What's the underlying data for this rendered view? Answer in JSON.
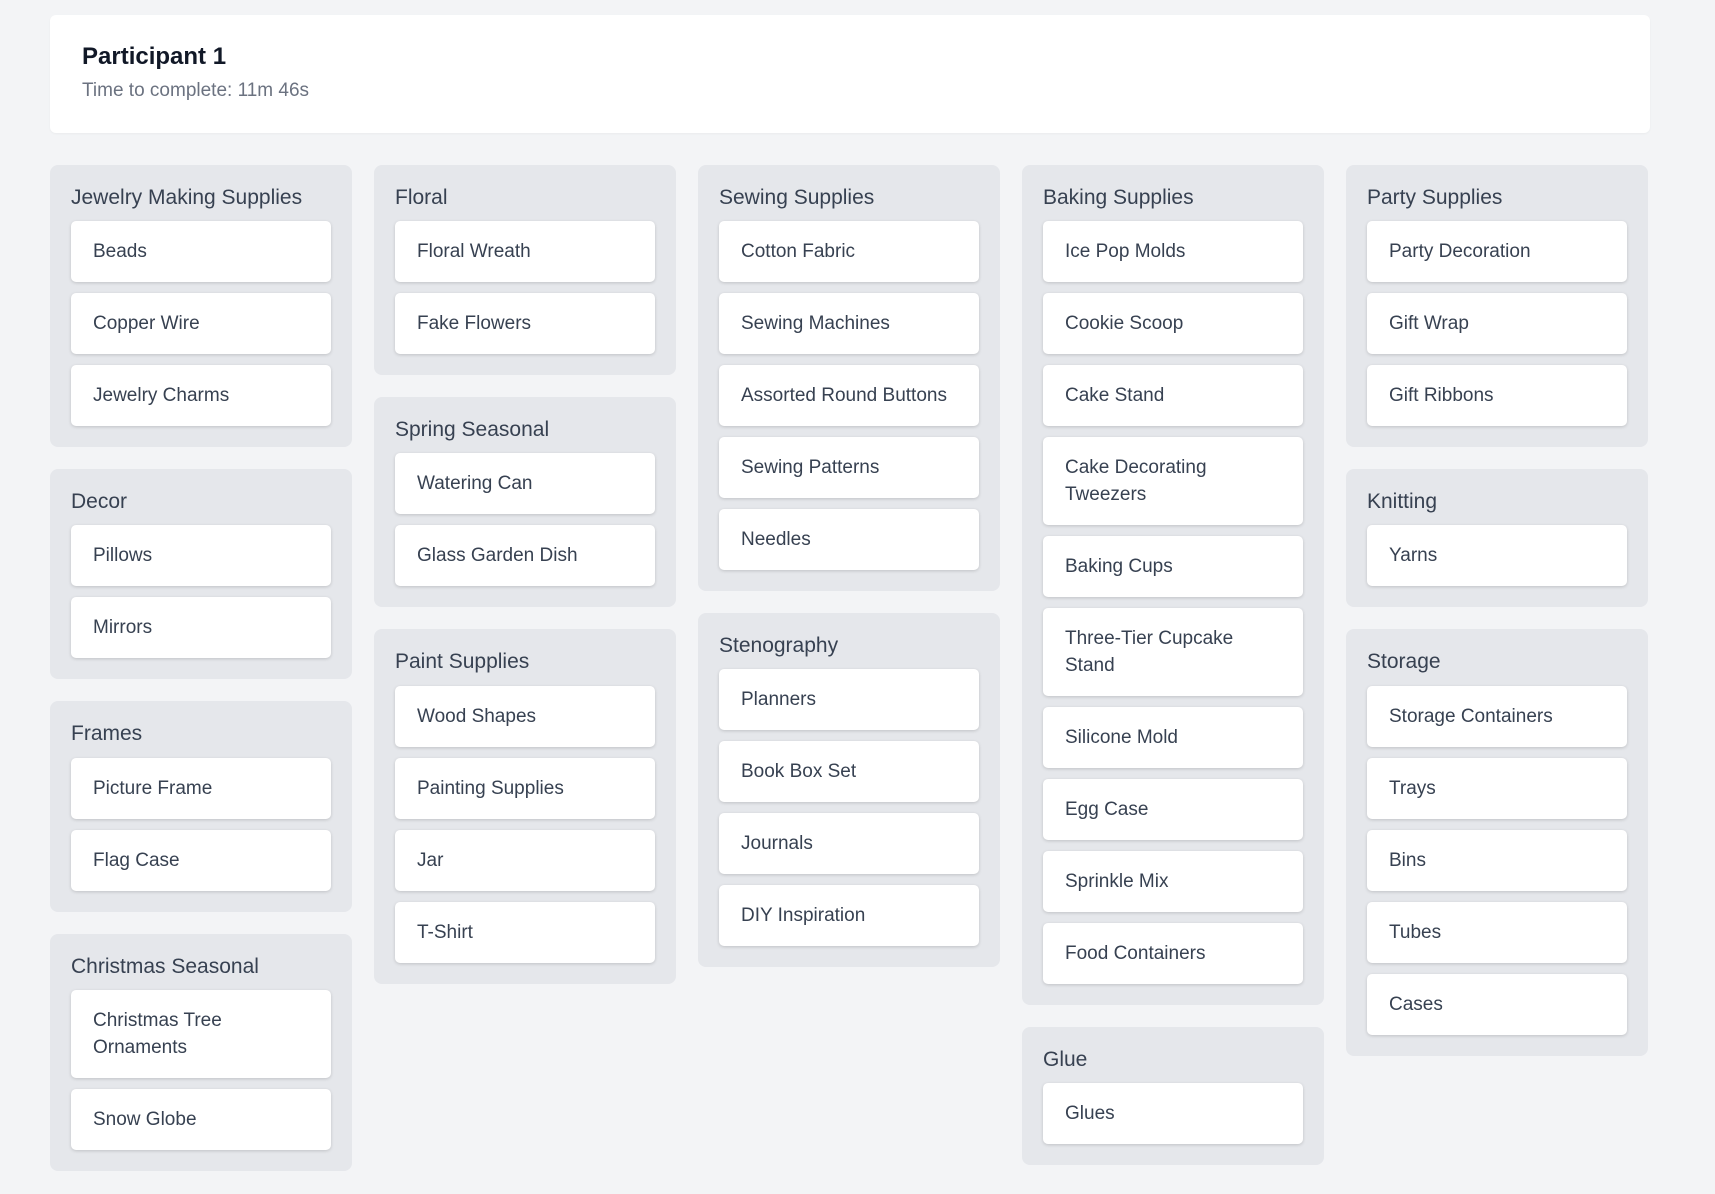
{
  "header": {
    "title": "Participant 1",
    "subtitle": "Time to complete: 11m 46s"
  },
  "columns": [
    [
      {
        "title": "Jewelry Making Supplies",
        "items": [
          "Beads",
          "Copper Wire",
          "Jewelry Charms"
        ]
      },
      {
        "title": "Decor",
        "items": [
          "Pillows",
          "Mirrors"
        ]
      },
      {
        "title": "Frames",
        "items": [
          "Picture Frame",
          "Flag Case"
        ]
      },
      {
        "title": "Christmas Seasonal",
        "items": [
          "Christmas Tree Ornaments",
          "Snow Globe"
        ]
      }
    ],
    [
      {
        "title": "Floral",
        "items": [
          "Floral Wreath",
          "Fake Flowers"
        ]
      },
      {
        "title": "Spring Seasonal",
        "items": [
          "Watering Can",
          "Glass Garden Dish"
        ]
      },
      {
        "title": "Paint Supplies",
        "items": [
          "Wood Shapes",
          "Painting Supplies",
          "Jar",
          "T-Shirt"
        ]
      }
    ],
    [
      {
        "title": "Sewing Supplies",
        "items": [
          "Cotton Fabric",
          "Sewing Machines",
          "Assorted Round Buttons",
          "Sewing Patterns",
          "Needles"
        ]
      },
      {
        "title": "Stenography",
        "items": [
          "Planners",
          "Book Box Set",
          "Journals",
          "DIY Inspiration"
        ]
      }
    ],
    [
      {
        "title": "Baking Supplies",
        "items": [
          "Ice Pop Molds",
          "Cookie Scoop",
          "Cake Stand",
          "Cake Decorating Tweezers",
          "Baking Cups",
          "Three-Tier Cupcake Stand",
          "Silicone Mold",
          "Egg Case",
          "Sprinkle Mix",
          "Food Containers"
        ]
      },
      {
        "title": "Glue",
        "items": [
          "Glues"
        ]
      }
    ],
    [
      {
        "title": "Party Supplies",
        "items": [
          "Party Decoration",
          "Gift Wrap",
          "Gift Ribbons"
        ]
      },
      {
        "title": "Knitting",
        "items": [
          "Yarns"
        ]
      },
      {
        "title": "Storage",
        "items": [
          "Storage Containers",
          "Trays",
          "Bins",
          "Tubes",
          "Cases"
        ]
      }
    ]
  ]
}
